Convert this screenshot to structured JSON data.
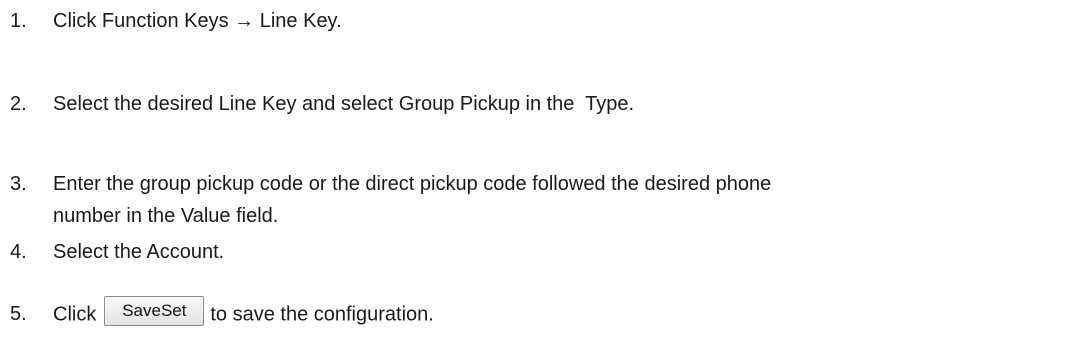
{
  "steps": [
    {
      "num": "1.",
      "text": "Click Function Keys → Line Key."
    },
    {
      "num": "2.",
      "text": "Select the desired Line Key and select Group Pickup in the  Type."
    },
    {
      "num": "3.",
      "line1": "Enter the group pickup code or the direct pickup code followed the desired phone",
      "line2": "number in the Value field."
    },
    {
      "num": "4.",
      "text": "Select the Account."
    },
    {
      "num": "5.",
      "before": "Click",
      "button_label": "SaveSet",
      "after": "to save the configuration."
    }
  ]
}
